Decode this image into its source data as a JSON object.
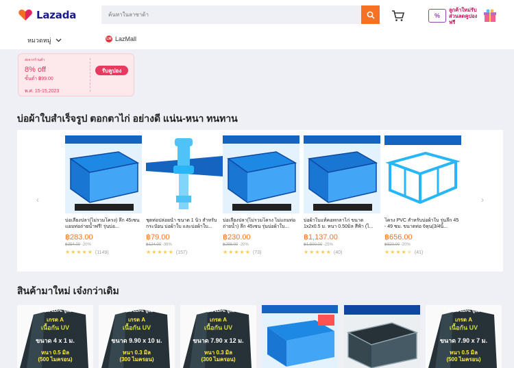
{
  "brand": {
    "name": "Lazada"
  },
  "search": {
    "placeholder": "ค้นหาในลาซาด้า"
  },
  "promo": {
    "badge": "%",
    "text": "ลูกค้าใหม่รับส่วนลดคูปองฟรี"
  },
  "nav": {
    "categories": "หมวดหมู่",
    "lazmall": "LazMall",
    "lazmall_badge": "LM"
  },
  "voucher": {
    "store_label": "ส่งจากร้านค้า",
    "discount": "8% off",
    "min_spend": "ขั้นต่ำ ฿99.00",
    "date": "พ.ศ. 15-15,2023",
    "button": "รับคูปอง"
  },
  "section1": {
    "title": "บ่อผ้าใบสำเร็จรูป ตอกตาไก่ อย่างดี แน่น-หนา ทนทาน"
  },
  "products": [
    {
      "name": "บ่อเลี้ยงปลา(ไม่รวมโครง) ลึก 45เซน แอมท่อถ่ายน้ำฟรี! รุ่นบ่อ...",
      "price": "฿283.00",
      "old": "฿354.00",
      "discount": "-20%",
      "rating": 5,
      "reviews": "(1149)",
      "accent": "#1e88e5"
    },
    {
      "name": "ชุดท่อปล่อยน้ำ ขนาด 1 นิ้ว สำหรับกระป๋อน บ่อผ้าใบ และบ่อผ้าใบ...",
      "price": "฿79.00",
      "old": "฿124.00",
      "discount": "-36%",
      "rating": 5,
      "reviews": "(157)",
      "accent": "#42a5f5"
    },
    {
      "name": "บ่อเลี้ยงปลา(ไม่รวมโครง ไม่แถมท่อถ่ายน้ำ) ลึก 45เซน รุ่นบ่อผ้าใบ...",
      "price": "฿230.00",
      "old": "฿288.00",
      "discount": "-20%",
      "rating": 5,
      "reviews": "(73)",
      "accent": "#1e88e5"
    },
    {
      "name": "บ่อผ้าใบแท้คอทกลาไก่ ขนาด 1x2x0.5 ม. หนา 0.50มิล สีฟ้า (ไ...",
      "price": "฿1,137.00",
      "old": "฿1,500.00",
      "discount": "-25%",
      "rating": 5,
      "reviews": "(40)",
      "accent": "#1976d2"
    },
    {
      "name": "โครง PVC สำหรับบ่อผ้าใบ รุ่นลึก 45 - 49 ซม. ขนาดท่อ 6หุน(3/4นิ้...",
      "price": "฿656.00",
      "old": "฿820.00",
      "discount": "-20%",
      "rating": 4.5,
      "reviews": "(41)",
      "accent": "#29b6f6"
    }
  ],
  "section2": {
    "title": "สินค้ามาใหม่ เจ๋งกว่าเดิม"
  },
  "new_items": [
    {
      "label1": "ผ้ายาง LDPE ปูบ่อ",
      "grade": "เกรด A",
      "uv": "เนื้อกัน UV",
      "size": "ขนาด 4 x 1 ม.",
      "thick": "หนา 0.5 มิล",
      "micron": "(500 ไมครอน)"
    },
    {
      "label1": "ผ้ายาง LDPE ปูบ่อ",
      "grade": "เกรด A",
      "uv": "เนื้อกัน UV",
      "size": "ขนาด 9.90 x 10 ม.",
      "thick": "หนา 0.3 มิล",
      "micron": "(300 ไมครอน)"
    },
    {
      "label1": "ผ้ายาง LDPE ปูบ่อ",
      "grade": "เกรด A",
      "uv": "เนื้อกัน UV",
      "size": "ขนาด 7.90 x 12 ม.",
      "thick": "หนา 0.3 มิล",
      "micron": "(300 ไมครอน)"
    },
    {
      "label1": "",
      "grade": "",
      "uv": "",
      "size": "",
      "thick": "",
      "micron": ""
    },
    {
      "label1": "",
      "grade": "",
      "uv": "",
      "size": "",
      "thick": "",
      "micron": ""
    },
    {
      "label1": "ผ้ายาง LDPE ปูบ่อ",
      "grade": "เกรด A",
      "uv": "เนื้อกัน UV",
      "size": "ขนาด 7.90 x 7 ม.",
      "thick": "หนา 0.5 มิล",
      "micron": "(500 ไมครอน)"
    }
  ],
  "colors": {
    "accent": "#f57224",
    "voucher": "#e83a5f",
    "star": "#faca51"
  }
}
